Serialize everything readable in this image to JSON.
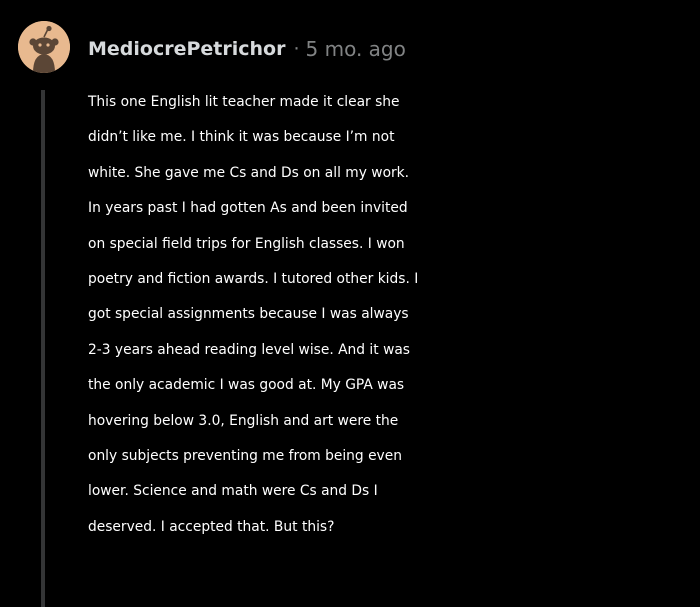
{
  "comment": {
    "username": "MediocrePetrichor",
    "separator": "·",
    "timestamp": "5 mo. ago",
    "avatar_icon": "snoo-avatar-icon",
    "colors": {
      "background": "#000000",
      "avatar": "#e8b98f",
      "username": "#d7dadc",
      "meta": "#818384",
      "thread_line": "#343536",
      "text": "#ffffff"
    },
    "body_lines": [
      "This one English lit teacher made it clear she",
      "didn’t like me. I think it was because I’m not",
      "white. She gave me Cs and Ds on all my work.",
      "In years past I had gotten As and been invited",
      "on special field trips for English classes. I won",
      "poetry and fiction awards. I tutored other kids. I",
      "got special assignments because I was always",
      "2-3 years ahead reading level wise. And it was",
      "the only academic I was good at. My GPA was",
      "hovering below 3.0, English and art were the",
      "only subjects preventing me from being even",
      "lower. Science and math were Cs and Ds I",
      "deserved. I accepted that. But this?"
    ]
  }
}
